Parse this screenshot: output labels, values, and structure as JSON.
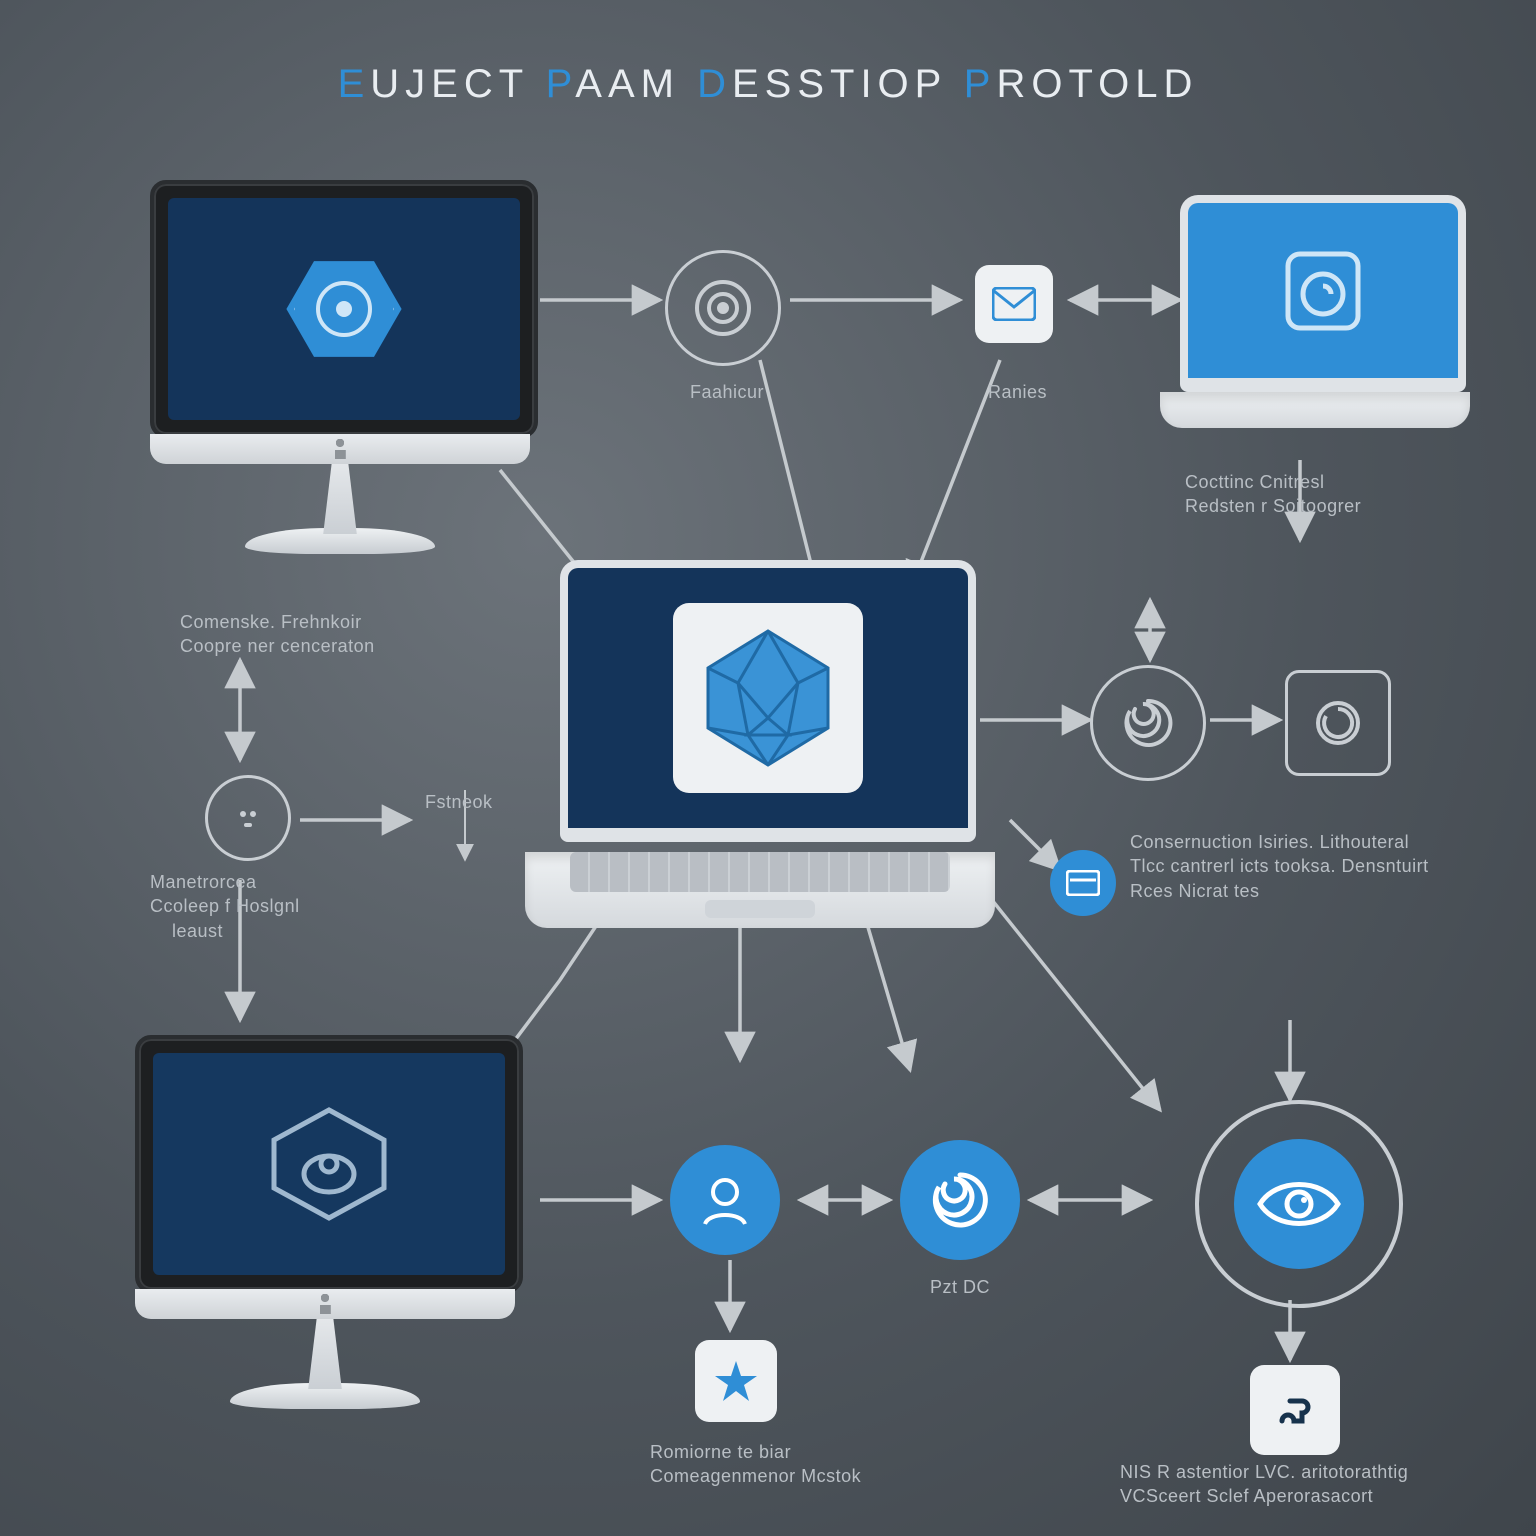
{
  "title": {
    "t1": "E",
    "t2": "UJECT ",
    "t3": "P",
    "t4": "AAM ",
    "t5": "D",
    "t6": "ESSTIOP ",
    "t7": "P",
    "t8": "ROTOLD"
  },
  "labels": {
    "faahicur": "Faahicur",
    "ranies": "Ranies",
    "topRightCaption": "Cocttinc Cnitresl\nRedsten r Soitoogrer",
    "leftDeskCaption": "Comenske. Frehnkoir\nCoopre ner cenceraton",
    "metCaption": "Manetrorcea\nCcoleep f Hoslgnl\n    leaust",
    "fstneok": "Fstneok",
    "rightMidCaption": "Consernuction Isiries. Lithouteral\nTlcc cantrerl icts tooksa. Densntuirt\nRces Nicrat tes",
    "pztDC": "Pzt DC",
    "bottomMidCaption": "Romiorne te biar\nComeagenmenor Mcstok",
    "bottomRightCaption": "NIS R astentior LVC. aritotorathtig\nVCSceert Sclef Aperorasacort"
  },
  "colors": {
    "blue": "#2f8ed6",
    "navy": "#14345a",
    "text": "#b9bfc5"
  }
}
